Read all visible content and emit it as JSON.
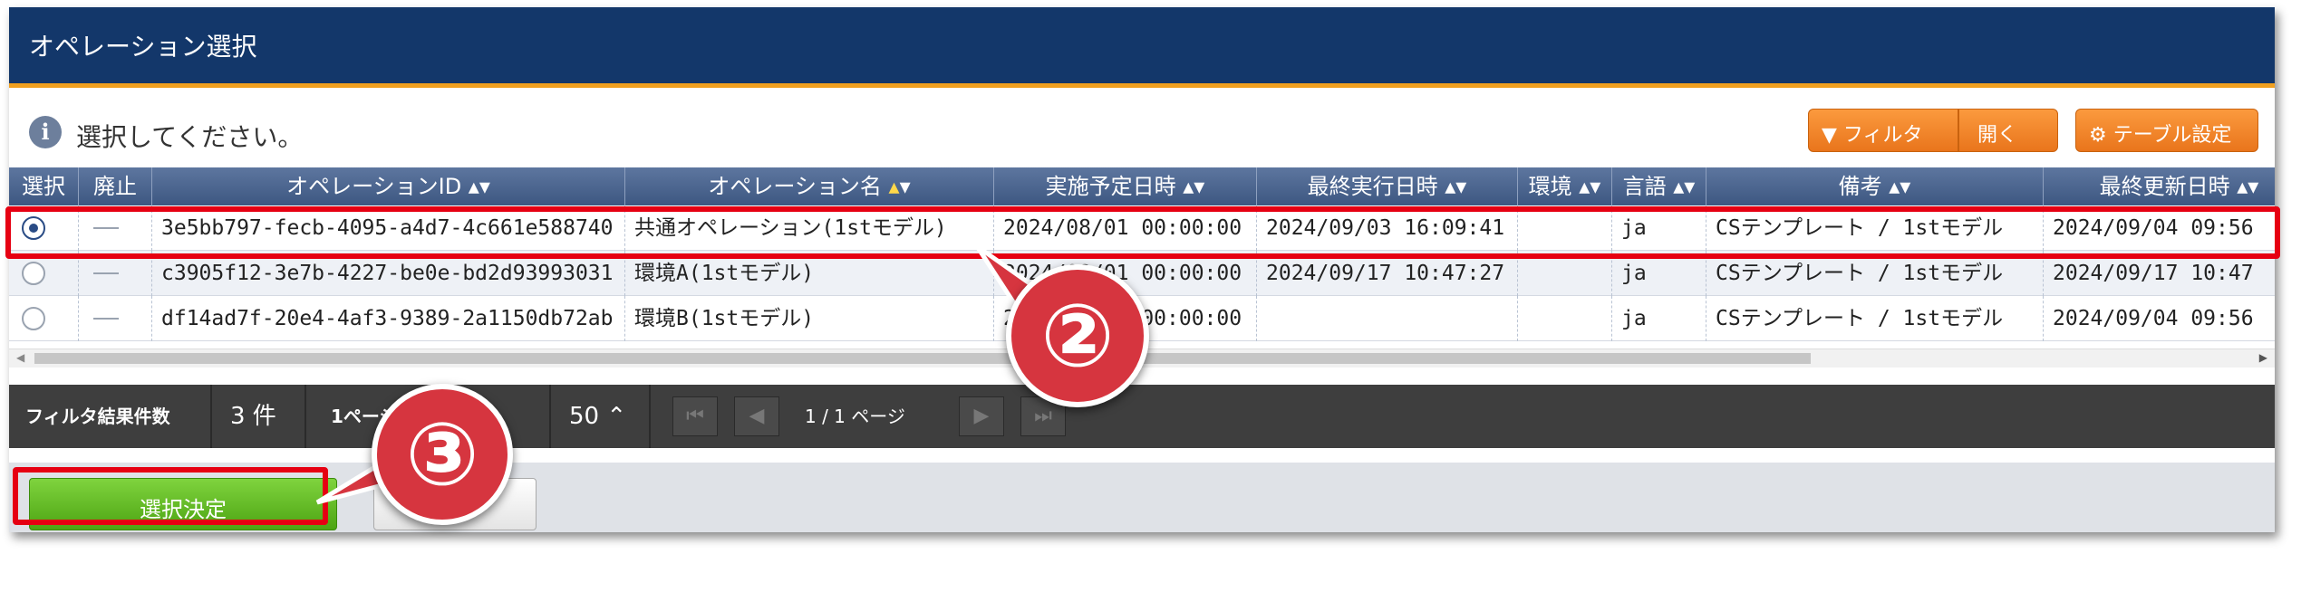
{
  "window": {
    "title": "オペレーション選択"
  },
  "info": {
    "icon": "info-icon",
    "text": "選択してください。"
  },
  "toolbar": {
    "filter_label": "フィルタ",
    "filter_open": "開く",
    "table_settings": "テーブル設定"
  },
  "table": {
    "headers": [
      "選択",
      "廃止",
      "オペレーションID",
      "オペレーション名",
      "実施予定日時",
      "最終実行日時",
      "環境",
      "言語",
      "備考",
      "最終更新日時"
    ],
    "rows": [
      {
        "selected": true,
        "id": "3e5bb797-fecb-4095-a4d7-4c661e588740",
        "name": "共通オペレーション(1stモデル)",
        "scheduled": "2024/08/01 00:00:00",
        "last_run": "2024/09/03 16:09:41",
        "env": "",
        "lang": "ja",
        "note": "CSテンプレート / 1stモデル",
        "updated": "2024/09/04 09:56"
      },
      {
        "selected": false,
        "id": "c3905f12-3e7b-4227-be0e-bd2d93993031",
        "name": "環境A(1stモデル)",
        "scheduled": "2024/08/01 00:00:00",
        "last_run": "2024/09/17 10:47:27",
        "env": "",
        "lang": "ja",
        "note": "CSテンプレート / 1stモデル",
        "updated": "2024/09/17 10:47"
      },
      {
        "selected": false,
        "id": "df14ad7f-20e4-4af3-9389-2a1150db72ab",
        "name": "環境B(1stモデル)",
        "scheduled": "2024/08/01 00:00:00",
        "last_run": "",
        "env": "",
        "lang": "ja",
        "note": "CSテンプレート / 1stモデル",
        "updated": "2024/09/04 09:56"
      }
    ]
  },
  "footer": {
    "filter_count_label": "フィルタ結果件数",
    "filter_count": "3 件",
    "per_page_label": "1ページ表示件数",
    "per_page": "50",
    "page_text": "1 / 1 ページ"
  },
  "actions": {
    "decide": "選択決定",
    "cancel": "閉じる"
  },
  "annotations": {
    "two": "②",
    "three": "③"
  },
  "colors": {
    "title_bg": "#13376a",
    "accent_orange": "#f0a020",
    "decide_green": "#5cb51c",
    "highlight_red": "#e60012",
    "callout_red": "#d6353f"
  }
}
